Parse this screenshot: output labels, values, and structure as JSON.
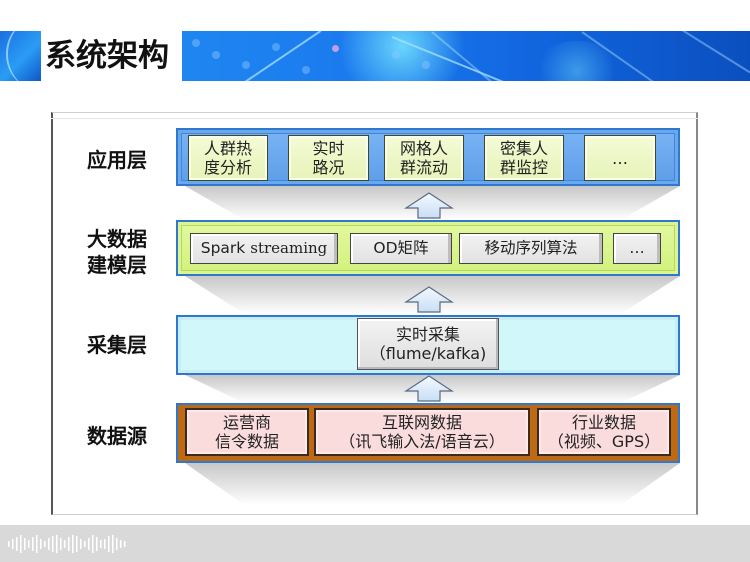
{
  "header": {
    "title": "系统架构"
  },
  "diagram": {
    "layers": [
      {
        "label_lines": [
          "应用层"
        ],
        "fill_color": "#5d9de8",
        "items": [
          {
            "lines": [
              "人群热",
              "度分析"
            ]
          },
          {
            "lines": [
              "实时",
              "路况"
            ]
          },
          {
            "lines": [
              "网格人",
              "群流动"
            ]
          },
          {
            "lines": [
              "密集人",
              "群监控"
            ]
          },
          {
            "lines": [
              "…"
            ]
          }
        ]
      },
      {
        "label_lines": [
          "大数据",
          "建模层"
        ],
        "fill_color": "#d1f27b",
        "items": [
          {
            "lines": [
              "Spark"
            ],
            "suffix": "streaming"
          },
          {
            "lines": [
              "OD矩阵"
            ]
          },
          {
            "lines": [
              "移动序列算法"
            ]
          },
          {
            "lines": [
              "…"
            ]
          }
        ]
      },
      {
        "label_lines": [
          "采集层"
        ],
        "fill_color": "#d2f7fb",
        "items": [
          {
            "lines": [
              "实时采集",
              "（flume/kafka)"
            ]
          }
        ]
      },
      {
        "label_lines": [
          "数据源"
        ],
        "fill_color": "#bf6913",
        "items": [
          {
            "lines": [
              "运营商",
              "信令数据"
            ]
          },
          {
            "lines": [
              "互联网数据",
              "（讯飞输入法/语音云）"
            ]
          },
          {
            "lines": [
              "行业数据",
              "（视频、GPS）"
            ]
          }
        ]
      }
    ],
    "arrows": [
      {
        "from": "采集层",
        "to": "大数据建模层",
        "icon": "up-arrow-icon"
      },
      {
        "from": "数据源",
        "to": "采集层",
        "icon": "up-arrow-icon"
      },
      {
        "from": "大数据建模层",
        "to": "应用层",
        "icon": "up-arrow-icon"
      }
    ]
  },
  "footer": {
    "logo_icon": "soundwave-logo-icon",
    "background_color": "#d9d9d9"
  }
}
